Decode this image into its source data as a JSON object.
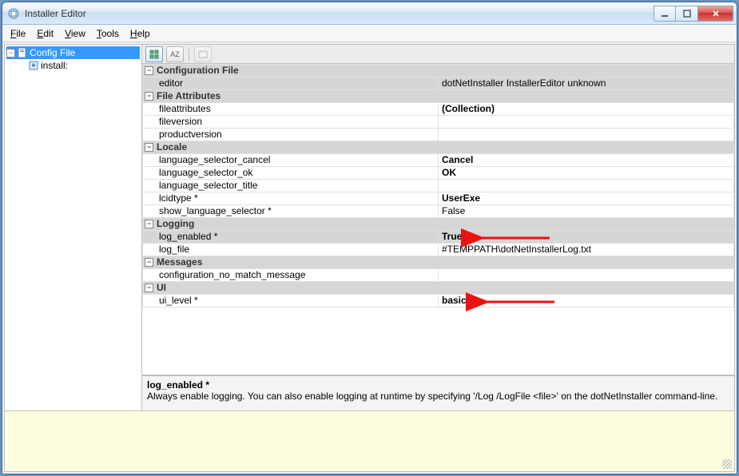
{
  "window": {
    "title": "Installer Editor"
  },
  "menus": [
    {
      "label": "File",
      "accel": "F"
    },
    {
      "label": "Edit",
      "accel": "E"
    },
    {
      "label": "View",
      "accel": "V"
    },
    {
      "label": "Tools",
      "accel": "T"
    },
    {
      "label": "Help",
      "accel": "H"
    }
  ],
  "tree": {
    "root": {
      "label": "Config File",
      "expanded": true
    },
    "child": {
      "label": "install:"
    }
  },
  "toolbar": {
    "categorized": "⊞",
    "alpha": "A↓",
    "pages": "▭"
  },
  "grid": {
    "categories": [
      {
        "name": "Configuration File",
        "props": [
          {
            "name": "editor",
            "value": "dotNetInstaller InstallerEditor unknown",
            "selected": true
          }
        ]
      },
      {
        "name": "File Attributes",
        "props": [
          {
            "name": "fileattributes",
            "value": "(Collection)",
            "bold": true
          },
          {
            "name": "fileversion",
            "value": ""
          },
          {
            "name": "productversion",
            "value": ""
          }
        ]
      },
      {
        "name": "Locale",
        "props": [
          {
            "name": "language_selector_cancel",
            "value": "Cancel",
            "bold": true
          },
          {
            "name": "language_selector_ok",
            "value": "OK",
            "bold": true
          },
          {
            "name": "language_selector_title",
            "value": ""
          },
          {
            "name": "lcidtype *",
            "value": "UserExe",
            "bold": true
          },
          {
            "name": "show_language_selector *",
            "value": "False"
          }
        ]
      },
      {
        "name": "Logging",
        "props": [
          {
            "name": "log_enabled *",
            "value": "True",
            "bold": true,
            "selected": true,
            "arrow": true
          },
          {
            "name": "log_file",
            "value": "#TEMPPATH\\dotNetInstallerLog.txt"
          }
        ]
      },
      {
        "name": "Messages",
        "props": [
          {
            "name": "configuration_no_match_message",
            "value": ""
          }
        ]
      },
      {
        "name": "UI",
        "props": [
          {
            "name": "ui_level *",
            "value": "basic",
            "bold": true,
            "arrow": true
          }
        ]
      }
    ]
  },
  "help": {
    "title": "log_enabled *",
    "body": "Always enable logging. You can also enable logging at runtime by specifying '/Log /LogFile <file>' on the dotNetInstaller command-line."
  }
}
